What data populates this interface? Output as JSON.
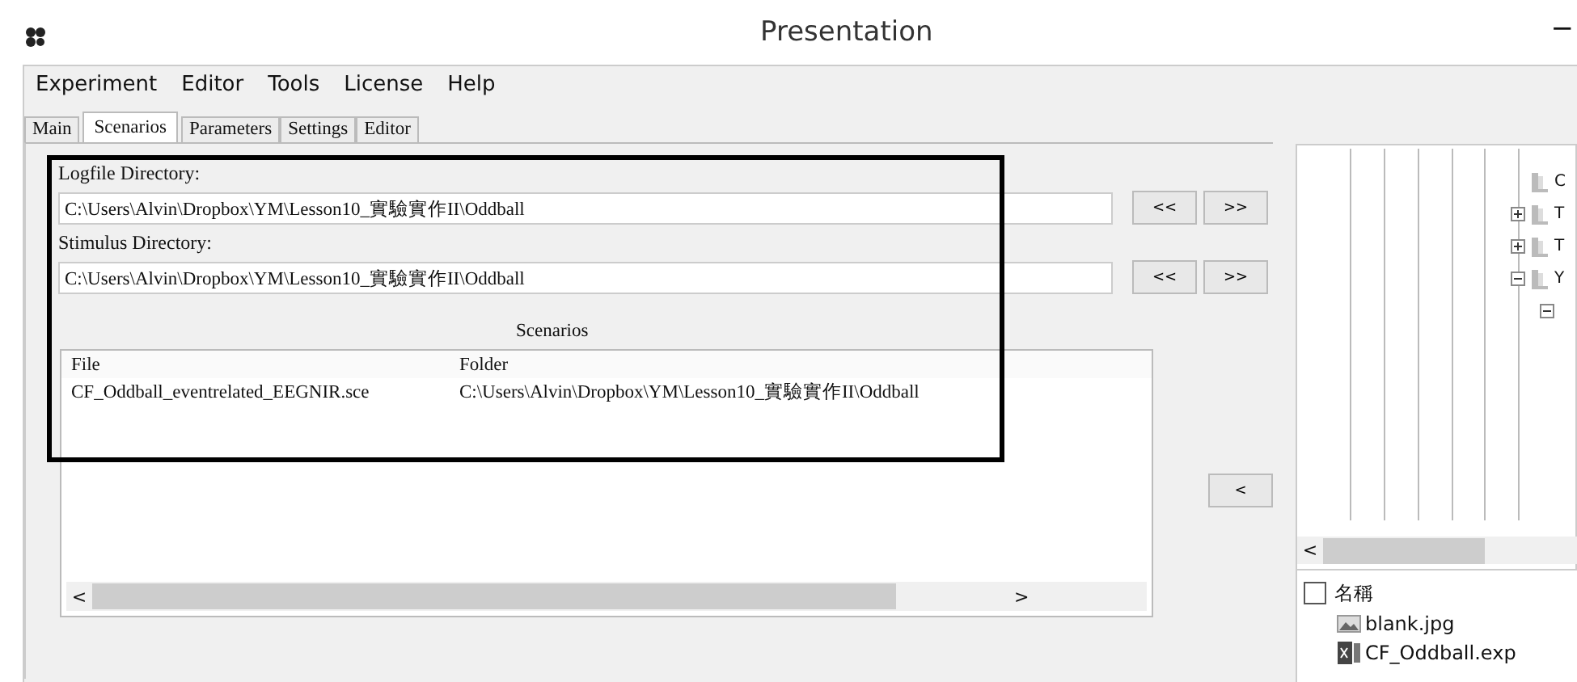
{
  "window": {
    "title": "Presentation",
    "minimize": "−"
  },
  "menu": [
    "Experiment",
    "Editor",
    "Tools",
    "License",
    "Help"
  ],
  "tabs": [
    {
      "label": "Main",
      "selected": false
    },
    {
      "label": "Scenarios",
      "selected": true
    },
    {
      "label": "Parameters",
      "selected": false
    },
    {
      "label": "Settings",
      "selected": false
    },
    {
      "label": "Editor",
      "selected": false
    }
  ],
  "directories": [
    {
      "label": "Logfile Directory:",
      "value": "C:\\Users\\Alvin\\Dropbox\\YM\\Lesson10_實驗實作II\\Oddball",
      "buttons": [
        "<<",
        ">>"
      ]
    },
    {
      "label": "Stimulus Directory:",
      "value": "C:\\Users\\Alvin\\Dropbox\\YM\\Lesson10_實驗實作II\\Oddball",
      "buttons": [
        "<<",
        ">>"
      ]
    }
  ],
  "scenarios": {
    "title": "Scenarios",
    "columns": [
      "File",
      "Folder"
    ],
    "rows": [
      [
        "CF_Oddball_eventrelated_EEGNIR.sce",
        "C:\\Users\\Alvin\\Dropbox\\YM\\Lesson10_實驗實作II\\Oddball"
      ]
    ],
    "scroll_left": "<",
    "scroll_right": ">"
  },
  "remove_button": "<",
  "tree": {
    "nodes": [
      {
        "kind": "leaf",
        "label": "C"
      },
      {
        "kind": "folder",
        "expanded": false,
        "label": "T"
      },
      {
        "kind": "folder",
        "expanded": false,
        "label": "T"
      },
      {
        "kind": "folder",
        "expanded": true,
        "label": "Y",
        "children": [
          {
            "kind": "folder",
            "expanded": true
          }
        ]
      }
    ],
    "scroll_left": "<"
  },
  "files": {
    "header": "名稱",
    "header_checked": false,
    "items": [
      {
        "name": "blank.jpg",
        "kind": "image"
      },
      {
        "name": "CF_Oddball.exp",
        "kind": "exp"
      }
    ]
  }
}
